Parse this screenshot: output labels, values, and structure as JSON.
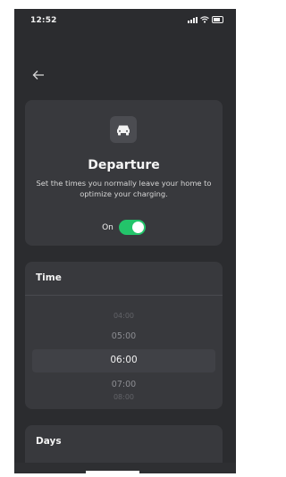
{
  "status_bar": {
    "time": "12:52"
  },
  "departure": {
    "title": "Departure",
    "description": "Set the times you normally leave your home to optimize your charging.",
    "toggle_label": "On",
    "toggle_state": "on"
  },
  "time_section": {
    "title": "Time",
    "options": [
      "04:00",
      "05:00",
      "06:00",
      "07:00",
      "08:00"
    ],
    "selected": "06:00"
  },
  "days_section": {
    "title": "Days"
  },
  "colors": {
    "background": "#2b2c2f",
    "card": "#38393d",
    "toggle_on": "#23c46a"
  },
  "icons": {
    "back": "arrow-left-icon",
    "car": "car-icon"
  }
}
